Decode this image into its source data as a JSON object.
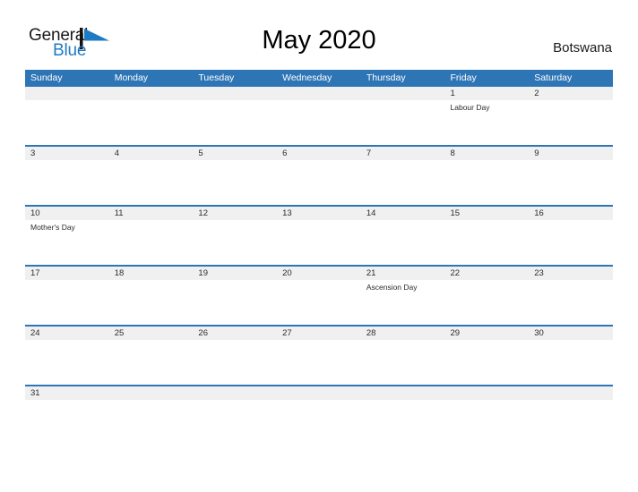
{
  "brand": {
    "name_part1": "General",
    "name_part2": "Blue",
    "color_dark": "#1a1a1a",
    "color_blue": "#1f7ac4",
    "flag_icon": "flag-triangle-icon"
  },
  "header": {
    "title": "May 2020",
    "country": "Botswana",
    "accent_color": "#2e75b6",
    "band_color": "#f0f0f0"
  },
  "weekdays": [
    "Sunday",
    "Monday",
    "Tuesday",
    "Wednesday",
    "Thursday",
    "Friday",
    "Saturday"
  ],
  "weeks": [
    {
      "days": [
        {
          "number": "",
          "events": []
        },
        {
          "number": "",
          "events": []
        },
        {
          "number": "",
          "events": []
        },
        {
          "number": "",
          "events": []
        },
        {
          "number": "",
          "events": []
        },
        {
          "number": "1",
          "events": [
            "Labour Day"
          ]
        },
        {
          "number": "2",
          "events": []
        }
      ]
    },
    {
      "days": [
        {
          "number": "3",
          "events": []
        },
        {
          "number": "4",
          "events": []
        },
        {
          "number": "5",
          "events": []
        },
        {
          "number": "6",
          "events": []
        },
        {
          "number": "7",
          "events": []
        },
        {
          "number": "8",
          "events": []
        },
        {
          "number": "9",
          "events": []
        }
      ]
    },
    {
      "days": [
        {
          "number": "10",
          "events": [
            "Mother's Day"
          ]
        },
        {
          "number": "11",
          "events": []
        },
        {
          "number": "12",
          "events": []
        },
        {
          "number": "13",
          "events": []
        },
        {
          "number": "14",
          "events": []
        },
        {
          "number": "15",
          "events": []
        },
        {
          "number": "16",
          "events": []
        }
      ]
    },
    {
      "days": [
        {
          "number": "17",
          "events": []
        },
        {
          "number": "18",
          "events": []
        },
        {
          "number": "19",
          "events": []
        },
        {
          "number": "20",
          "events": []
        },
        {
          "number": "21",
          "events": [
            "Ascension Day"
          ]
        },
        {
          "number": "22",
          "events": []
        },
        {
          "number": "23",
          "events": []
        }
      ]
    },
    {
      "days": [
        {
          "number": "24",
          "events": []
        },
        {
          "number": "25",
          "events": []
        },
        {
          "number": "26",
          "events": []
        },
        {
          "number": "27",
          "events": []
        },
        {
          "number": "28",
          "events": []
        },
        {
          "number": "29",
          "events": []
        },
        {
          "number": "30",
          "events": []
        }
      ]
    },
    {
      "last": true,
      "days": [
        {
          "number": "31",
          "events": []
        },
        {
          "number": "",
          "events": []
        },
        {
          "number": "",
          "events": []
        },
        {
          "number": "",
          "events": []
        },
        {
          "number": "",
          "events": []
        },
        {
          "number": "",
          "events": []
        },
        {
          "number": "",
          "events": []
        }
      ]
    }
  ]
}
